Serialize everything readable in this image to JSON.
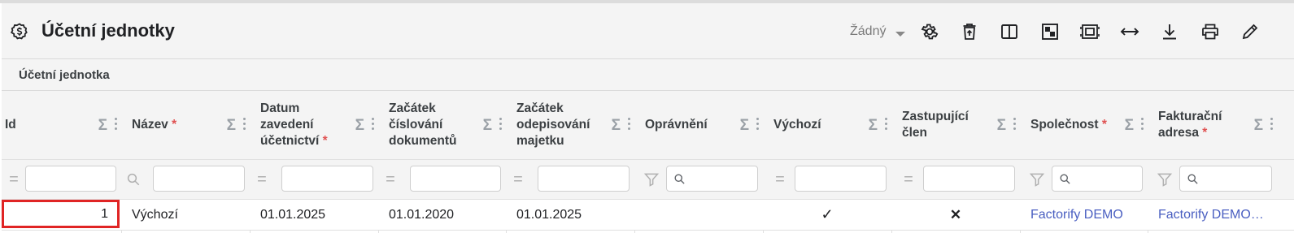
{
  "header": {
    "title": "Účetní jednotky",
    "view_selector": "Žádný"
  },
  "toolbar_icons": [
    "gear-icon",
    "delete-icon",
    "columns-icon",
    "layout-icon",
    "fit-icon",
    "expand-horizontal-icon",
    "download-icon",
    "print-icon",
    "edit-icon"
  ],
  "subheader": {
    "label": "Účetní jednotka"
  },
  "columns": [
    {
      "label": "Id",
      "required": false,
      "filter": "equals"
    },
    {
      "label": "Název",
      "required": true,
      "filter": "search"
    },
    {
      "label": "Datum zavedení účetnictví",
      "required": true,
      "filter": "equals"
    },
    {
      "label": "Začátek číslování dokumentů",
      "required": false,
      "filter": "equals"
    },
    {
      "label": "Začátek odepisování majetku",
      "required": false,
      "filter": "equals"
    },
    {
      "label": "Oprávnění",
      "required": false,
      "filter": "funnel"
    },
    {
      "label": "Výchozí",
      "required": false,
      "filter": "equals"
    },
    {
      "label": "Zastupující člen",
      "required": false,
      "filter": "equals"
    },
    {
      "label": "Společnost",
      "required": true,
      "filter": "funnel"
    },
    {
      "label": "Fakturační adresa",
      "required": true,
      "filter": "funnel"
    }
  ],
  "row": {
    "id": "1",
    "nazev": "Výchozí",
    "datum_zavedeni": "01.01.2025",
    "zacatek_cislovani": "01.01.2020",
    "zacatek_odepisovani": "01.01.2025",
    "opravneni": "",
    "vychozi": "✓",
    "zastupujici": "✕",
    "spolecnost": "Factorify DEMO",
    "fakturacni_adresa": "Factorify DEMO, s.r.o."
  },
  "required_marker": "*",
  "colors": {
    "required": "#e05252",
    "link": "#4a5fc1",
    "selection": "#e02424"
  }
}
